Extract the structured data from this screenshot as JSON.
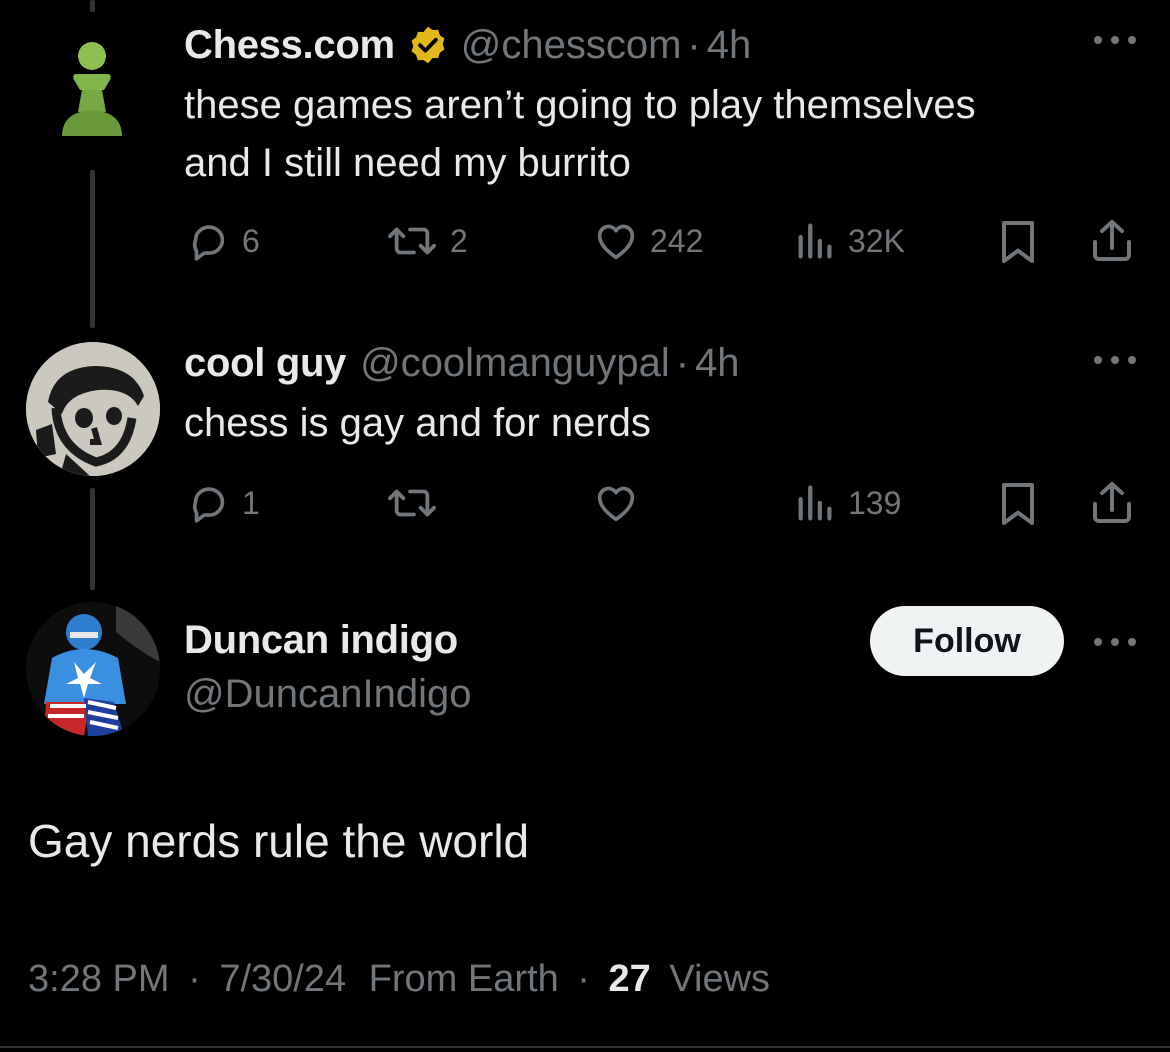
{
  "tweets": [
    {
      "name": "Chess.com",
      "handle": "@chesscom",
      "time": "4h",
      "text_line1": "these games aren’t going to play themselves",
      "text_line2": "and I still need my burrito",
      "replies": "6",
      "retweets": "2",
      "likes": "242",
      "views": "32K"
    },
    {
      "name": "cool guy",
      "handle": "@coolmanguypal",
      "time": "4h",
      "text_line1": "chess is gay and for nerds",
      "replies": "1",
      "retweets": "",
      "likes": "",
      "views": "139"
    }
  ],
  "main_tweet": {
    "name": "Duncan indigo",
    "handle": "@DuncanIndigo",
    "follow_label": "Follow",
    "text": "Gay nerds rule the world",
    "time": "3:28 PM",
    "date": "7/30/24",
    "location": "From Earth",
    "views_count": "27",
    "views_label": "Views"
  },
  "separator": "·",
  "colors": {
    "background": "#000000",
    "text": "#e7e9ea",
    "muted": "#71767b",
    "verified_gold": "#e2b719",
    "chess_pawn_green": "#81b64c"
  }
}
